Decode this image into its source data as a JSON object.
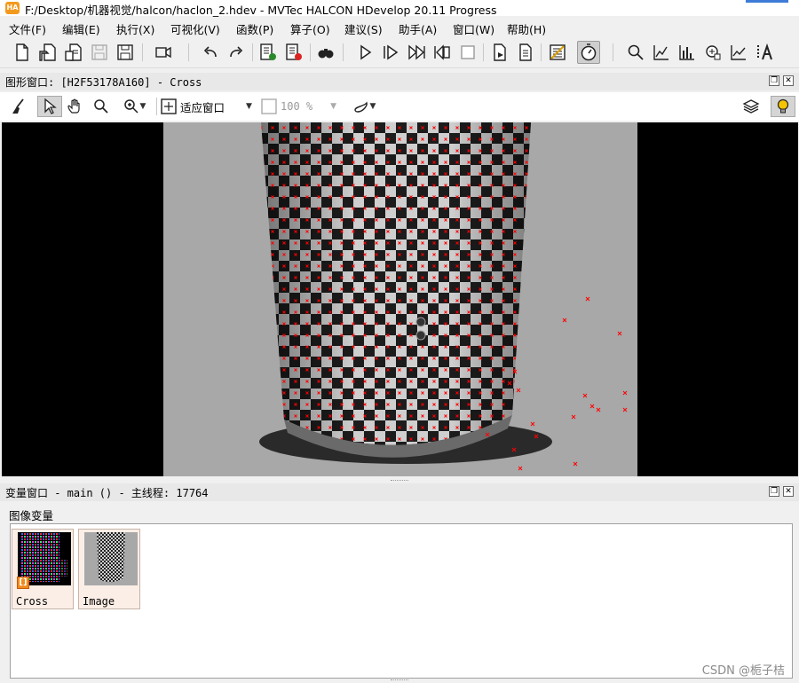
{
  "window": {
    "app_icon_text": "HA",
    "title": "F:/Desktop/机器视觉/halcon/haclon_2.hdev - MVTec HALCON HDevelop 20.11 Progress"
  },
  "menu": {
    "items": [
      {
        "label": "文件(F)"
      },
      {
        "label": "编辑(E)"
      },
      {
        "label": "执行(X)"
      },
      {
        "label": "可视化(V)"
      },
      {
        "label": "函数(P)"
      },
      {
        "label": "算子(O)"
      },
      {
        "label": "建议(S)"
      },
      {
        "label": "助手(A)"
      },
      {
        "label": "窗口(W)"
      },
      {
        "label": "帮助(H)"
      }
    ]
  },
  "toolbar": {
    "buttons": [
      "new-file-icon",
      "open-file-icon",
      "browse-examples-icon",
      "save-disabled-icon",
      "save-as-icon",
      "record-icon",
      "undo-icon",
      "redo-icon",
      "insert-code-icon",
      "delete-code-icon",
      "find-icon",
      "run-icon",
      "step-over-icon",
      "step-into-icon",
      "step-out-icon",
      "stop-icon",
      "reset-icon",
      "reset-all-icon",
      "variable-inspect-icon",
      "profiler-icon",
      "zoom-icon",
      "histogram-icon",
      "line-profile-icon",
      "gray-histogram-icon",
      "feature-histogram-icon",
      "ocr-icon"
    ],
    "active": "profiler-icon"
  },
  "graphics_window": {
    "title": "图形窗口: [H2F53178A160] - Cross",
    "fit_label": "适应窗口",
    "zoom_label": "100 %",
    "active_tool": "pointer-icon"
  },
  "variable_window": {
    "title": "变量窗口 - main () - 主线程: 17764",
    "section_label": "图像变量",
    "variables": [
      {
        "name": "Cross",
        "badge": "[]"
      },
      {
        "name": "Image"
      }
    ]
  },
  "watermark": "CSDN @栀子桔",
  "colors": {
    "marker": "#ff0000",
    "highlight_bulb": "#f5c400",
    "app_logo": "#f39a1e"
  }
}
